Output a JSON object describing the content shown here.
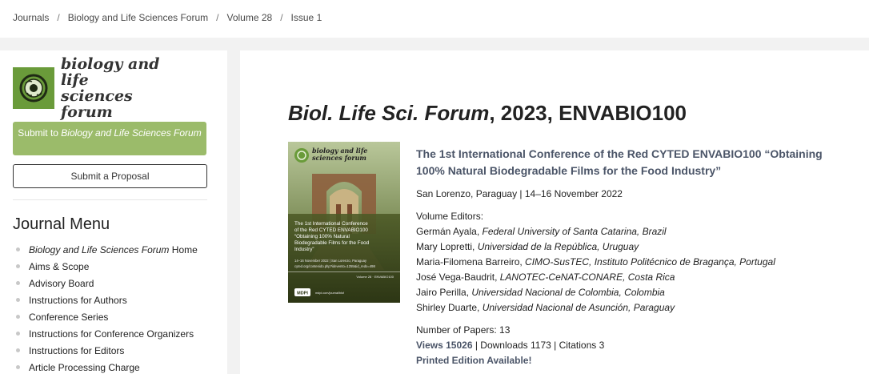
{
  "breadcrumb": {
    "items": [
      "Journals",
      "Biology and Life Sciences Forum",
      "Volume 28",
      "Issue 1"
    ],
    "separator": "/"
  },
  "sidebar": {
    "logo_line1": "biology and life",
    "logo_line2": "sciences forum",
    "submit_prefix": "Submit to ",
    "submit_journal": "Biology and Life Sciences Forum",
    "proposal_label": "Submit a Proposal",
    "menu_title": "Journal Menu",
    "menu_first_em": "Biology and Life Sciences Forum",
    "menu_first_rest": " Home",
    "menu_items": [
      "Aims & Scope",
      "Advisory Board",
      "Instructions for Authors",
      "Conference Series",
      "Instructions for Conference Organizers",
      "Instructions for Editors",
      "Article Processing Charge"
    ]
  },
  "issue": {
    "title_journal": "Biol. Life Sci. Forum",
    "title_rest": ", 2023, ENVABIO100",
    "conference_title": "The 1st International Conference of the Red CYTED ENVABIO100 “Obtaining 100% Natural Biodegradable Films for the Food Industry”",
    "location_date": "San Lorenzo, Paraguay | 14–16 November 2022",
    "editors_label": "Volume Editors:",
    "editors": [
      {
        "name": "Germán Ayala",
        "affiliation": "Federal University of Santa Catarina, Brazil"
      },
      {
        "name": "Mary Lopretti",
        "affiliation": "Universidad de la República, Uruguay"
      },
      {
        "name": "Maria-Filomena Barreiro",
        "affiliation": "CIMO-SusTEC, Instituto Politécnico de Bragança, Portugal"
      },
      {
        "name": "José Vega-Baudrit",
        "affiliation": "LANOTEC-CeNAT-CONARE, Costa Rica"
      },
      {
        "name": "Jairo Perilla",
        "affiliation": "Universidad Nacional de Colombia, Colombia"
      },
      {
        "name": "Shirley Duarte",
        "affiliation": "Universidad Nacional de Asunción, Paraguay"
      }
    ],
    "papers_label": "Number of Papers: 13",
    "views": "Views 15026",
    "downloads_citations": " | Downloads 1173 | Citations 3",
    "printed": "Printed Edition Available!"
  },
  "cover": {
    "journal_line1": "biology and life",
    "journal_line2": "sciences forum",
    "title_lines": [
      "The 1st International Conference",
      "of the Red CYTED ENVABIO100",
      "“Obtaining 100% Natural",
      "Biodegradable Films for the Food",
      "Industry”"
    ],
    "meta_lines": [
      "14–16 November 2022 | San Lorenzo, Paraguay",
      "cyted.org/contenido.php?idevento=1255&id_redo=498"
    ],
    "volume_text": "Volume 28 · ENVABIO100",
    "publisher": "MDPI",
    "publisher_line": "mdpi.com/journal/blsf",
    "brand_color": "#6a9b3a"
  }
}
